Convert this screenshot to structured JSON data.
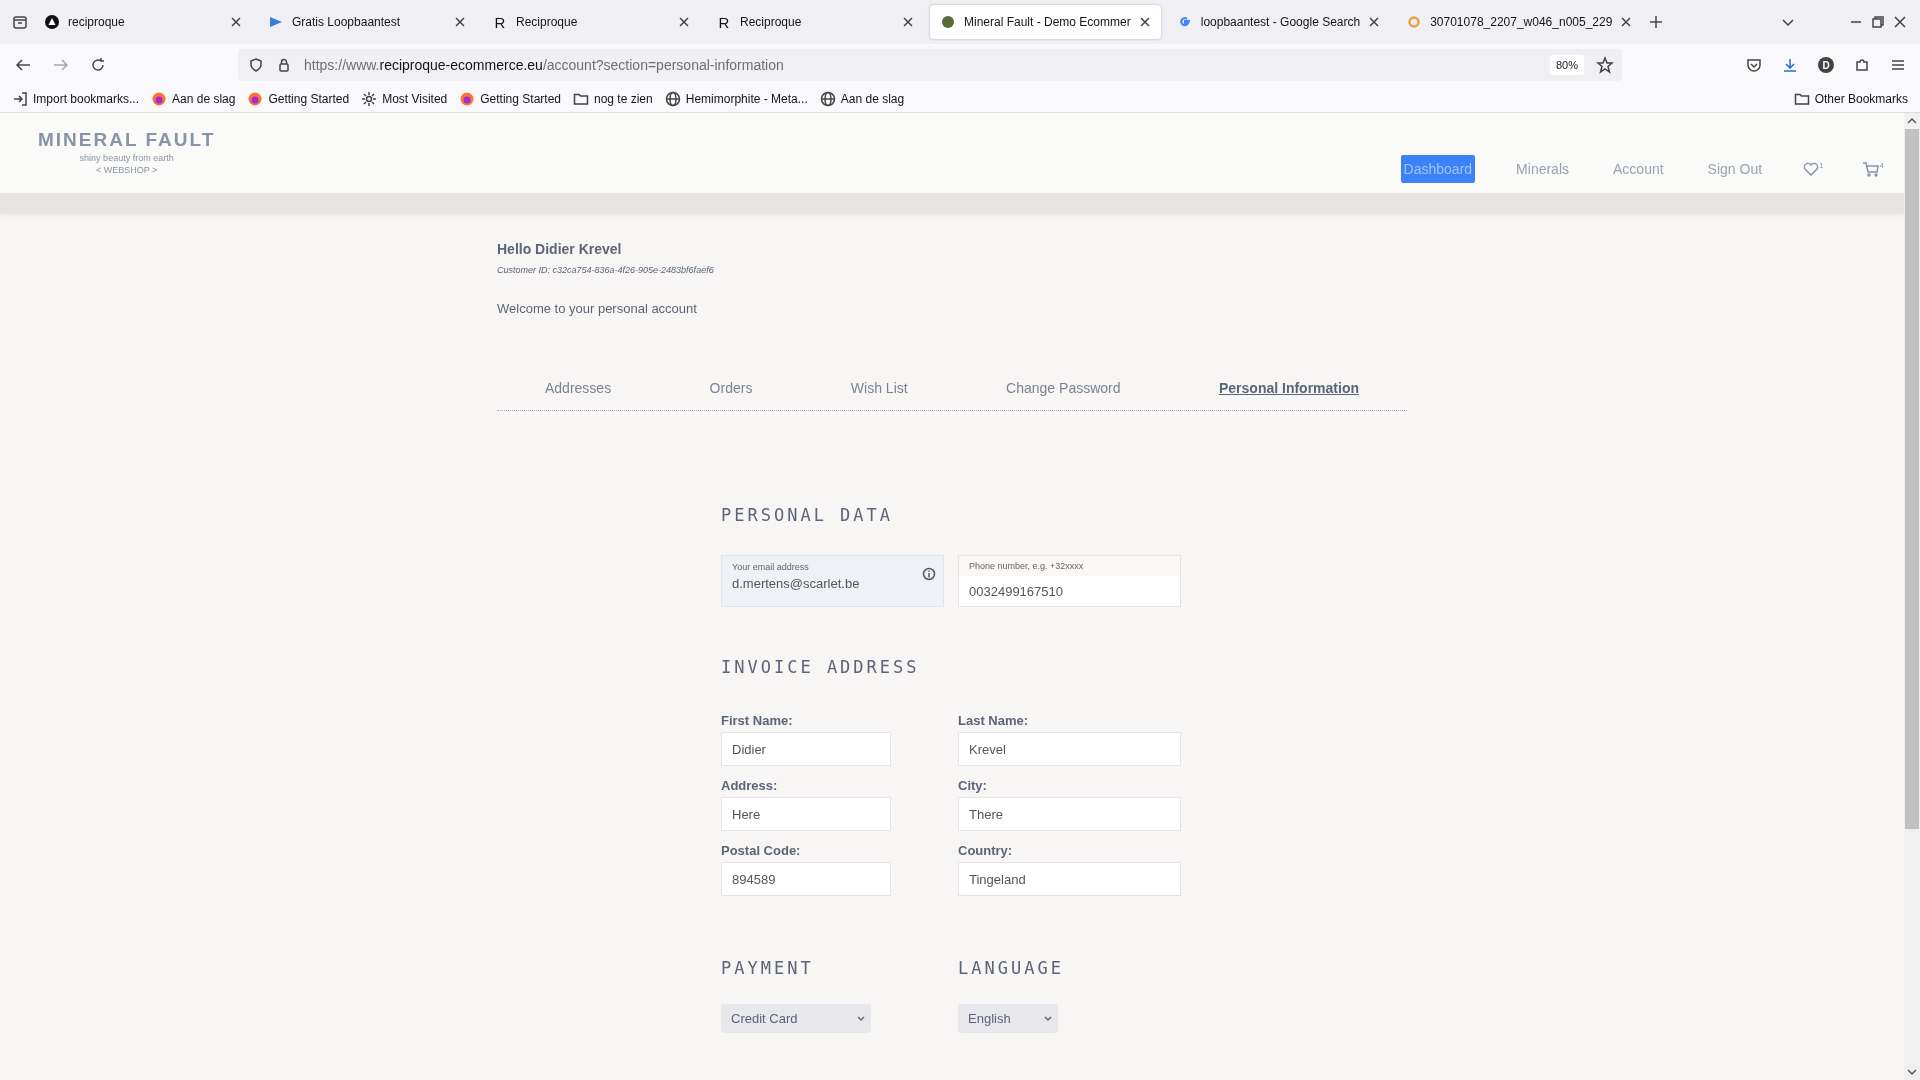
{
  "browser": {
    "tabs": [
      {
        "title": "reciproque",
        "selected": false
      },
      {
        "title": "Gratis Loopbaantest",
        "selected": false
      },
      {
        "title": "Reciproque",
        "icon_text": "R",
        "selected": false
      },
      {
        "title": "Reciproque",
        "icon_text": "R",
        "selected": false
      },
      {
        "title": "Mineral Fault - Demo Ecommer",
        "selected": true
      },
      {
        "title": "loopbaantest - Google Search",
        "selected": false
      },
      {
        "title": "30701078_2207_w046_n005_229",
        "selected": false
      }
    ],
    "url_parts": [
      "https://www.",
      "reciproque-ecommerce.eu",
      "/account?section=personal-information"
    ],
    "zoom": "80%",
    "profile_initial": "D",
    "bookmarks": [
      {
        "label": "Import bookmarks..."
      },
      {
        "label": "Aan de slag"
      },
      {
        "label": "Getting Started"
      },
      {
        "label": "Most Visited"
      },
      {
        "label": "Getting Started"
      },
      {
        "label": "nog te zien"
      },
      {
        "label": "Hemimorphite - Meta..."
      },
      {
        "label": "Aan de slag"
      }
    ],
    "other_bookmarks": "Other Bookmarks"
  },
  "site": {
    "logo": "MINERAL FAULT",
    "tagline": "shiny beauty from earth",
    "sub": "< WEBSHOP >",
    "nav": [
      {
        "label": "Dashboard",
        "selected": true
      },
      {
        "label": "Minerals",
        "selected": false
      },
      {
        "label": "Account",
        "selected": false
      },
      {
        "label": "Sign Out",
        "selected": false
      }
    ],
    "wishlist_count": "1",
    "cart_count": "4"
  },
  "greeting": "Hello Didier Krevel",
  "customer_id": "Customer ID: c32ca754-836a-4f26-905e-2483bf6faef6",
  "welcome": "Welcome to your personal account",
  "account_tabs": [
    {
      "label": "Addresses",
      "selected": false
    },
    {
      "label": "Orders",
      "selected": false
    },
    {
      "label": "Wish List",
      "selected": false
    },
    {
      "label": "Change Password",
      "selected": false
    },
    {
      "label": "Personal Information",
      "selected": true
    }
  ],
  "personal_data": {
    "title": "PERSONAL DATA",
    "email": {
      "label": "Your email address",
      "value": "d.mertens@scarlet.be",
      "disabled": true
    },
    "phone": {
      "placeholder": "Phone number, e.g. +32xxxx",
      "value": "0032499167510"
    }
  },
  "invoice_address": {
    "title": "INVOICE ADDRESS",
    "fields": [
      {
        "label": "First Name:",
        "value": "Didier"
      },
      {
        "label": "Last Name:",
        "value": "Krevel"
      },
      {
        "label": "Address:",
        "value": "Here"
      },
      {
        "label": "City:",
        "value": "There"
      },
      {
        "label": "Postal Code:",
        "value": "894589"
      },
      {
        "label": "Country:",
        "value": "Tingeland"
      }
    ]
  },
  "payment": {
    "title": "PAYMENT",
    "value": "Credit Card"
  },
  "language": {
    "title": "LANGUAGE",
    "value": "English"
  }
}
